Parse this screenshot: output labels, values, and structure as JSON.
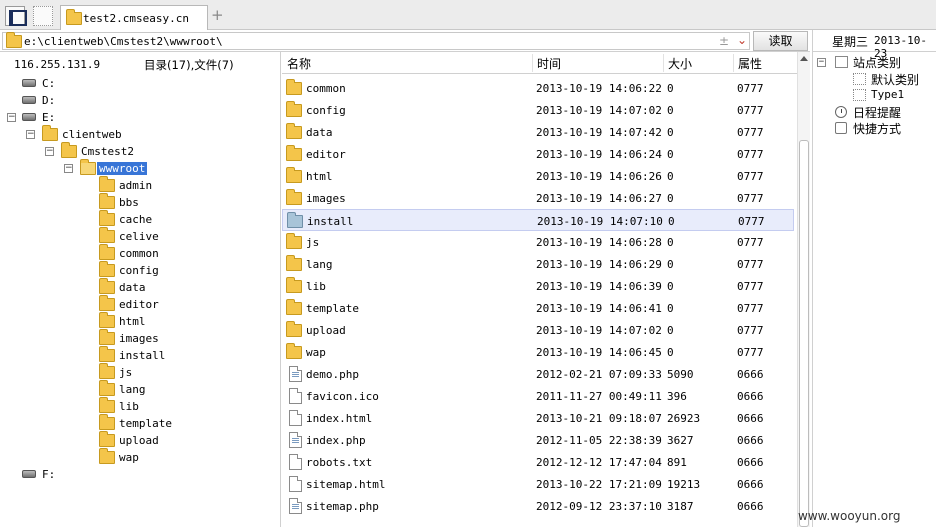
{
  "tab": {
    "title": "test2.cmseasy.cn"
  },
  "address": {
    "path": "e:\\clientweb\\Cmstest2\\wwwroot\\",
    "read_label": "读取"
  },
  "left": {
    "ip": "116.255.131.9",
    "counts": "目录(17),文件(7)",
    "tree": {
      "drives": [
        "C:",
        "D:",
        "E:",
        "F:"
      ],
      "clientweb": "clientweb",
      "cmstest2": "Cmstest2",
      "wwwroot": "wwwroot",
      "children": [
        "admin",
        "bbs",
        "cache",
        "celive",
        "common",
        "config",
        "data",
        "editor",
        "html",
        "images",
        "install",
        "js",
        "lang",
        "lib",
        "template",
        "upload",
        "wap"
      ]
    }
  },
  "list": {
    "columns": {
      "name": "名称",
      "time": "时间",
      "size": "大小",
      "attr": "属性"
    },
    "rows": [
      {
        "name": "common",
        "time": "2013-10-19 14:06:22",
        "size": "0",
        "attr": "0777",
        "type": "folder"
      },
      {
        "name": "config",
        "time": "2013-10-19 14:07:02",
        "size": "0",
        "attr": "0777",
        "type": "folder"
      },
      {
        "name": "data",
        "time": "2013-10-19 14:07:42",
        "size": "0",
        "attr": "0777",
        "type": "folder"
      },
      {
        "name": "editor",
        "time": "2013-10-19 14:06:24",
        "size": "0",
        "attr": "0777",
        "type": "folder"
      },
      {
        "name": "html",
        "time": "2013-10-19 14:06:26",
        "size": "0",
        "attr": "0777",
        "type": "folder"
      },
      {
        "name": "images",
        "time": "2013-10-19 14:06:27",
        "size": "0",
        "attr": "0777",
        "type": "folder"
      },
      {
        "name": "install",
        "time": "2013-10-19 14:07:10",
        "size": "0",
        "attr": "0777",
        "type": "folder-install"
      },
      {
        "name": "js",
        "time": "2013-10-19 14:06:28",
        "size": "0",
        "attr": "0777",
        "type": "folder"
      },
      {
        "name": "lang",
        "time": "2013-10-19 14:06:29",
        "size": "0",
        "attr": "0777",
        "type": "folder"
      },
      {
        "name": "lib",
        "time": "2013-10-19 14:06:39",
        "size": "0",
        "attr": "0777",
        "type": "folder"
      },
      {
        "name": "template",
        "time": "2013-10-19 14:06:41",
        "size": "0",
        "attr": "0777",
        "type": "folder"
      },
      {
        "name": "upload",
        "time": "2013-10-19 14:07:02",
        "size": "0",
        "attr": "0777",
        "type": "folder"
      },
      {
        "name": "wap",
        "time": "2013-10-19 14:06:45",
        "size": "0",
        "attr": "0777",
        "type": "folder"
      },
      {
        "name": "demo.php",
        "time": "2012-02-21 07:09:33",
        "size": "5090",
        "attr": "0666",
        "type": "php"
      },
      {
        "name": "favicon.ico",
        "time": "2011-11-27 00:49:11",
        "size": "396",
        "attr": "0666",
        "type": "file"
      },
      {
        "name": "index.html",
        "time": "2013-10-21 09:18:07",
        "size": "26923",
        "attr": "0666",
        "type": "file"
      },
      {
        "name": "index.php",
        "time": "2012-11-05 22:38:39",
        "size": "3627",
        "attr": "0666",
        "type": "php"
      },
      {
        "name": "robots.txt",
        "time": "2012-12-12 17:47:04",
        "size": "891",
        "attr": "0666",
        "type": "file"
      },
      {
        "name": "sitemap.html",
        "time": "2013-10-22 17:21:09",
        "size": "19213",
        "attr": "0666",
        "type": "file"
      },
      {
        "name": "sitemap.php",
        "time": "2012-09-12 23:37:10",
        "size": "3187",
        "attr": "0666",
        "type": "php"
      }
    ]
  },
  "right": {
    "weekday": "星期三",
    "date": "2013-10-23",
    "site_category": "站点类别",
    "default_category": "默认类别",
    "type1": "Type1",
    "schedule": "日程提醒",
    "shortcuts": "快捷方式"
  },
  "watermark": "www.wooyun.org",
  "colors": {
    "selection": "#3875d7",
    "row_highlight": "#e8ecfb",
    "folder": "#f4c54a"
  }
}
